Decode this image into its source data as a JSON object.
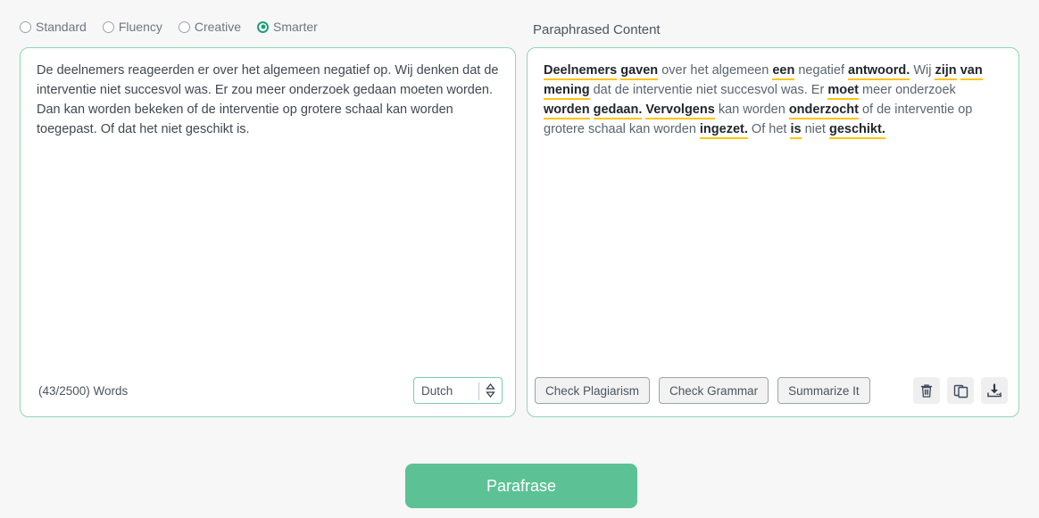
{
  "modes": {
    "options": [
      {
        "label": "Standard",
        "selected": false
      },
      {
        "label": "Fluency",
        "selected": false
      },
      {
        "label": "Creative",
        "selected": false
      },
      {
        "label": "Smarter",
        "selected": true
      }
    ]
  },
  "right_panel": {
    "heading": "Paraphrased Content",
    "segments": [
      {
        "text": "Deelnemers",
        "highlight": true
      },
      {
        "text": " ",
        "highlight": false
      },
      {
        "text": "gaven",
        "highlight": true
      },
      {
        "text": " over het algemeen ",
        "highlight": false
      },
      {
        "text": "een",
        "highlight": true
      },
      {
        "text": " negatief ",
        "highlight": false
      },
      {
        "text": "antwoord.",
        "highlight": true
      },
      {
        "text": " Wij ",
        "highlight": false
      },
      {
        "text": "zijn",
        "highlight": true
      },
      {
        "text": " ",
        "highlight": false
      },
      {
        "text": "van",
        "highlight": true
      },
      {
        "text": " ",
        "highlight": false
      },
      {
        "text": "mening",
        "highlight": true
      },
      {
        "text": " dat de interventie niet succesvol was. Er ",
        "highlight": false
      },
      {
        "text": "moet",
        "highlight": true
      },
      {
        "text": " meer onderzoek ",
        "highlight": false
      },
      {
        "text": "worden",
        "highlight": true
      },
      {
        "text": " ",
        "highlight": false
      },
      {
        "text": "gedaan.",
        "highlight": true
      },
      {
        "text": " ",
        "highlight": false
      },
      {
        "text": "Vervolgens",
        "highlight": true
      },
      {
        "text": " kan worden ",
        "highlight": false
      },
      {
        "text": "onderzocht",
        "highlight": true
      },
      {
        "text": " of de interventie op grotere schaal kan worden ",
        "highlight": false
      },
      {
        "text": "ingezet.",
        "highlight": true
      },
      {
        "text": " Of het ",
        "highlight": false
      },
      {
        "text": "is",
        "highlight": true
      },
      {
        "text": " niet ",
        "highlight": false
      },
      {
        "text": "geschikt.",
        "highlight": true
      }
    ],
    "buttons": {
      "check_plagiarism": "Check Plagiarism",
      "check_grammar": "Check Grammar",
      "summarize": "Summarize It"
    },
    "icons": {
      "delete": "trash-icon",
      "copy": "copy-icon",
      "download": "download-icon"
    }
  },
  "left_panel": {
    "text": "De deelnemers reageerden er over het algemeen negatief op. Wij denken dat de interventie niet succesvol was. Er zou meer onderzoek gedaan moeten worden. Dan kan worden bekeken of de interventie op grotere schaal kan worden toegepast. Of dat het niet geschikt is.",
    "word_count": "(43/2500) Words",
    "language": "Dutch"
  },
  "action": {
    "label": "Parafrase"
  },
  "colors": {
    "accent_green": "#5cc295",
    "panel_border": "#8fd6b4",
    "radio_selected": "#1f9d78",
    "highlight_underline": "#FFC40C",
    "page_background": "#f7f7f7"
  }
}
